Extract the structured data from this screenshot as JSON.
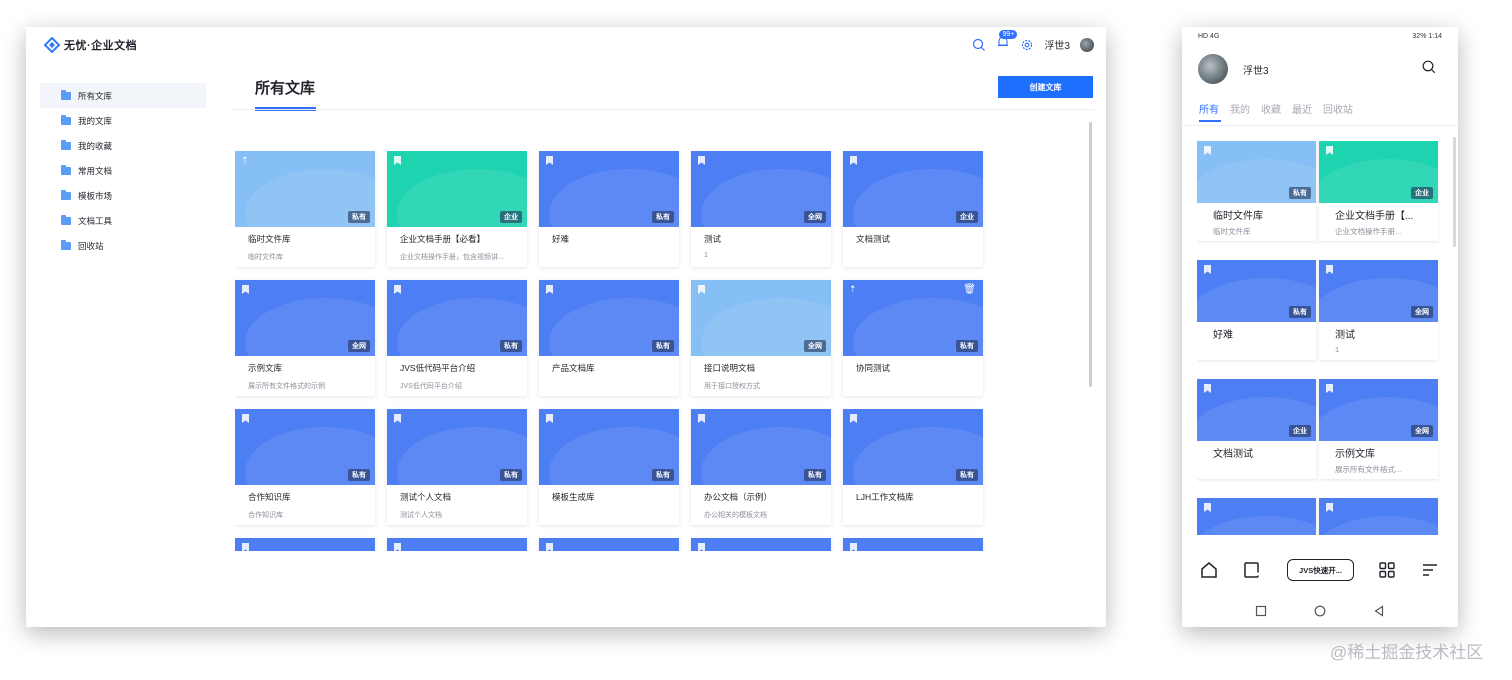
{
  "desktop": {
    "logo_text": "无忧·企业文档",
    "notification_count": "99+",
    "user_name": "浮世3",
    "sidebar": [
      {
        "label": "所有文库",
        "active": true
      },
      {
        "label": "我的文库"
      },
      {
        "label": "我的收藏"
      },
      {
        "label": "常用文档"
      },
      {
        "label": "模板市场"
      },
      {
        "label": "文档工具"
      },
      {
        "label": "回收站"
      }
    ],
    "page_title": "所有文库",
    "create_button": "创建文库",
    "cards": [
      {
        "title": "临时文件库",
        "desc": "临时文件库",
        "tag": "私有",
        "color": "light",
        "icon": "pin"
      },
      {
        "title": "企业文档手册【必看】",
        "desc": "企业文档操作手册，包含视频讲...",
        "tag": "企业",
        "color": "teal",
        "icon": "bookmark"
      },
      {
        "title": "好难",
        "desc": "",
        "tag": "私有",
        "color": "blue",
        "icon": "bookmark"
      },
      {
        "title": "测试",
        "desc": "1",
        "tag": "全网",
        "color": "blue",
        "icon": "bookmark"
      },
      {
        "title": "文档测试",
        "desc": "",
        "tag": "企业",
        "color": "blue",
        "icon": "bookmark"
      },
      {
        "title": "示例文库",
        "desc": "展示所有文件格式的示例",
        "tag": "全网",
        "color": "blue",
        "icon": "bookmark"
      },
      {
        "title": "JVS低代码平台介绍",
        "desc": "JVS低代码平台介绍",
        "tag": "私有",
        "color": "blue",
        "icon": "bookmark"
      },
      {
        "title": "产品文档库",
        "desc": "",
        "tag": "私有",
        "color": "blue",
        "icon": "bookmark"
      },
      {
        "title": "接口说明文档",
        "desc": "用于接口授权方式",
        "tag": "全网",
        "color": "light",
        "icon": "bookmark"
      },
      {
        "title": "协同测试",
        "desc": "",
        "tag": "私有",
        "color": "blue",
        "icon": "pin",
        "trash": true
      },
      {
        "title": "合作知识库",
        "desc": "合作知识库",
        "tag": "私有",
        "color": "blue",
        "icon": "bookmark"
      },
      {
        "title": "测试个人文档",
        "desc": "测试个人文档",
        "tag": "私有",
        "color": "blue",
        "icon": "bookmark"
      },
      {
        "title": "模板生成库",
        "desc": "",
        "tag": "私有",
        "color": "blue",
        "icon": "bookmark"
      },
      {
        "title": "办公文档（示例）",
        "desc": "办公相关的模板文档",
        "tag": "私有",
        "color": "blue",
        "icon": "bookmark"
      },
      {
        "title": "LJH工作文档库",
        "desc": "",
        "tag": "私有",
        "color": "blue",
        "icon": "bookmark"
      },
      {
        "title": "",
        "desc": "",
        "tag": "",
        "color": "blue",
        "icon": "bookmark"
      },
      {
        "title": "",
        "desc": "",
        "tag": "",
        "color": "blue",
        "icon": "bookmark"
      },
      {
        "title": "",
        "desc": "",
        "tag": "",
        "color": "blue",
        "icon": "bookmark"
      },
      {
        "title": "",
        "desc": "",
        "tag": "",
        "color": "blue",
        "icon": "bookmark"
      },
      {
        "title": "",
        "desc": "",
        "tag": "",
        "color": "blue",
        "icon": "bookmark"
      }
    ]
  },
  "mobile": {
    "status_left": "HD 4G",
    "status_right": "32% 1:14",
    "user_name": "浮世3",
    "tabs": [
      {
        "label": "所有",
        "active": true
      },
      {
        "label": "我的"
      },
      {
        "label": "收藏"
      },
      {
        "label": "最近"
      },
      {
        "label": "回收站"
      }
    ],
    "cards": [
      {
        "title": "临时文件库",
        "desc": "临时文件库",
        "tag": "私有",
        "color": "light"
      },
      {
        "title": "企业文档手册【...",
        "desc": "企业文档操作手册...",
        "tag": "企业",
        "color": "teal"
      },
      {
        "title": "好难",
        "desc": "",
        "tag": "私有",
        "color": "blue"
      },
      {
        "title": "测试",
        "desc": "1",
        "tag": "全网",
        "color": "blue"
      },
      {
        "title": "文档测试",
        "desc": "",
        "tag": "企业",
        "color": "blue"
      },
      {
        "title": "示例文库",
        "desc": "展示所有文件格式...",
        "tag": "全网",
        "color": "blue"
      },
      {
        "title": "",
        "desc": "",
        "tag": "",
        "color": "blue"
      },
      {
        "title": "",
        "desc": "",
        "tag": "",
        "color": "blue"
      }
    ],
    "quick_pill": "JVS快速开..."
  },
  "watermark": "@稀土掘金技术社区",
  "colors": {
    "primary": "#1f6fff",
    "card_blue": "#4d7ef3",
    "card_teal": "#1dd3b0",
    "card_light": "#85bff5"
  }
}
